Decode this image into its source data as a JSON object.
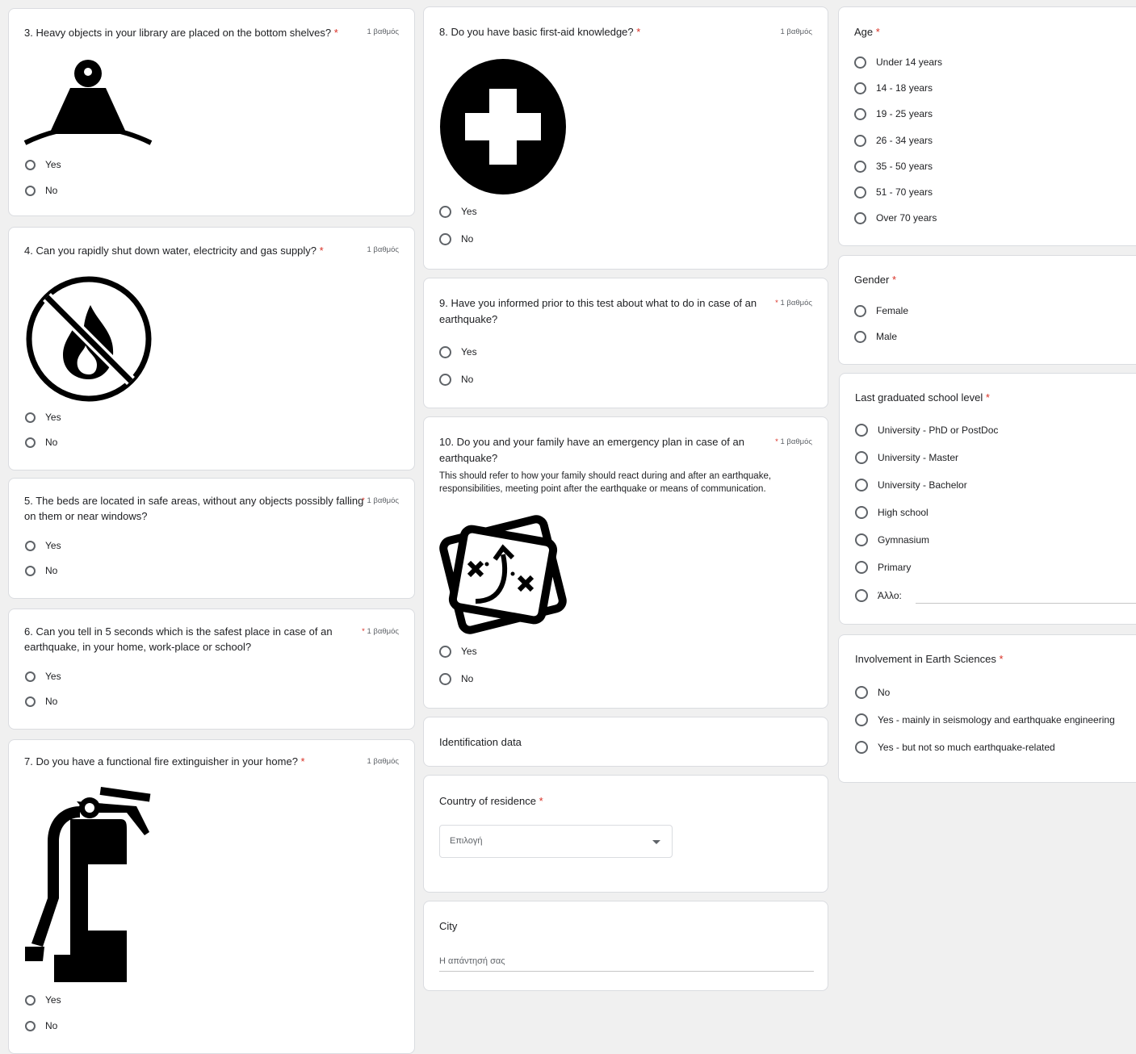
{
  "col1": {
    "q3": {
      "title": "3. Heavy objects in your library are placed on the bottom shelves?",
      "required": "*",
      "points": "1 βαθμός",
      "icon": "weight-icon",
      "options": [
        "Yes",
        "No"
      ]
    },
    "q4": {
      "title": "4. Can you rapidly shut down water, electricity and gas supply?",
      "required": "*",
      "points": "1 βαθμός",
      "icon": "no-fire-icon",
      "options": [
        "Yes",
        "No"
      ]
    },
    "q5": {
      "title_l1": "5. The beds are located in safe areas, without any objects possibly falling",
      "title_l2": "on them or near windows?",
      "required": "*",
      "points": "1 βαθμός",
      "options": [
        "Yes",
        "No"
      ]
    },
    "q6": {
      "title_l1": "6. Can you tell in 5 seconds which is the safest place in case of an",
      "title_l2": "earthquake, in your home, work-place or school?",
      "required": "*",
      "points": "1 βαθμός",
      "options": [
        "Yes",
        "No"
      ]
    },
    "q7": {
      "title": "7. Do you have a functional fire extinguisher in your home?",
      "required": "*",
      "points": "1 βαθμός",
      "icon": "fire-extinguisher-icon",
      "options": [
        "Yes",
        "No"
      ]
    }
  },
  "col2": {
    "q8": {
      "title": "8. Do you have basic first-aid knowledge?",
      "required": "*",
      "points": "1 βαθμός",
      "icon": "first-aid-cross-icon",
      "options": [
        "Yes",
        "No"
      ]
    },
    "q9": {
      "title_l1": "9. Have you informed prior to this test about what to do in case of an",
      "title_l2": "earthquake?",
      "required": "*",
      "points": "1 βαθμός",
      "options": [
        "Yes",
        "No"
      ]
    },
    "q10": {
      "title_l1": "10. Do you and your family have an emergency plan in case of an",
      "title_l2": "earthquake?",
      "desc_l1": "This should refer to how your family should react during and after an earthquake,",
      "desc_l2": "responsibilities, meeting point after the earthquake or means of communication.",
      "required": "*",
      "points": "1 βαθμός",
      "icon": "plan-map-icon",
      "options": [
        "Yes",
        "No"
      ]
    },
    "section": {
      "title": "Identification data"
    },
    "country": {
      "label": "Country of residence",
      "required": "*",
      "placeholder": "Επιλογή"
    },
    "city": {
      "label": "City",
      "placeholder": "Η απάντησή σας"
    }
  },
  "col3": {
    "age": {
      "label": "Age",
      "required": "*",
      "options": [
        "Under 14 years",
        "14 - 18 years",
        "19 - 25 years",
        "26 - 34 years",
        "35 - 50 years",
        "51 - 70 years",
        "Over 70 years"
      ]
    },
    "gender": {
      "label": "Gender",
      "required": "*",
      "options": [
        "Female",
        "Male"
      ]
    },
    "school": {
      "label": "Last graduated school level",
      "required": "*",
      "options": [
        "University - PhD or PostDoc",
        "University - Master",
        "University - Bachelor",
        "High school",
        "Gymnasium",
        "Primary",
        "Άλλο:"
      ]
    },
    "earth": {
      "label": "Involvement in Earth Sciences",
      "required": "*",
      "options": [
        "No",
        "Yes - mainly in seismology and earthquake engineering",
        "Yes - but not so much earthquake-related"
      ]
    }
  },
  "colors": {
    "required": "#d93025",
    "radio": "#5f6368",
    "border": "#dadce0",
    "icon": "#000000"
  }
}
